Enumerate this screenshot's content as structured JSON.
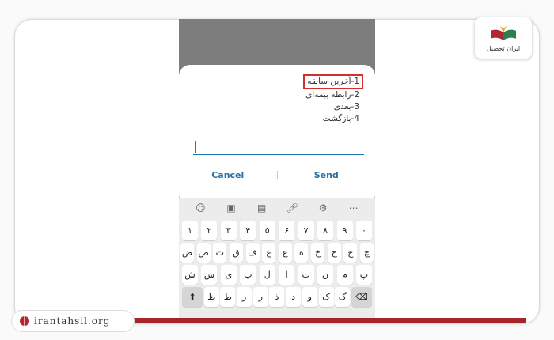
{
  "dialog": {
    "menu": [
      "1-آخرین سابقه",
      "2-رابطه بیمه‌ای",
      "3-بعدی",
      "4-بازگشت"
    ],
    "cancel_label": "Cancel",
    "send_label": "Send"
  },
  "keyboard": {
    "toolbar_icons": [
      "emoji-icon",
      "sticker-icon",
      "clipboard-icon",
      "mic-icon",
      "gear-icon",
      "more-icon"
    ],
    "row1": [
      "١",
      "٢",
      "٣",
      "۴",
      "۵",
      "۶",
      "٧",
      "٨",
      "٩",
      "٠"
    ],
    "row2": [
      "ض",
      "ص",
      "ث",
      "ق",
      "ف",
      "غ",
      "ع",
      "ه",
      "خ",
      "ح",
      "ج",
      "چ"
    ],
    "row3": [
      "ش",
      "س",
      "ی",
      "ب",
      "ل",
      "ا",
      "ت",
      "ن",
      "م",
      "پ"
    ],
    "row4": [
      "ظ",
      "ط",
      "ز",
      "ر",
      "ذ",
      "د",
      "و",
      "ک",
      "گ"
    ]
  },
  "brand": {
    "logo_text": "ایران تحصیل",
    "url": "irantahsil.org",
    "accent": "#a6252b"
  }
}
